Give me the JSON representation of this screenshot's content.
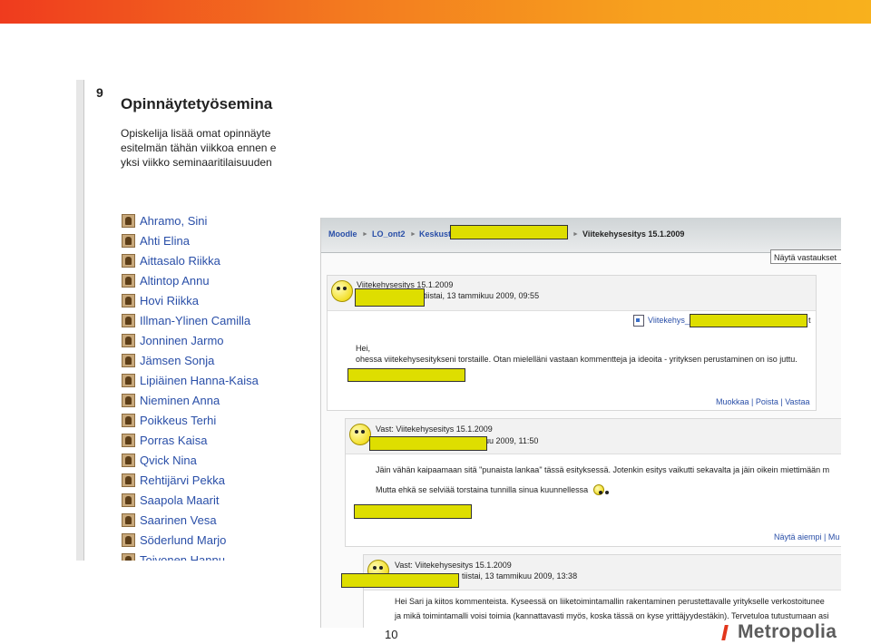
{
  "left_screenshot": {
    "week_number": "9",
    "title": "Opinnäytetyösemina",
    "description_lines": [
      "Opiskelija lisää omat opinnäyte",
      "esitelmän tähän viikkoa ennen e",
      "yksi viikko seminaaritilaisuuden"
    ],
    "students": [
      "Ahramo, Sini",
      "Ahti Elina",
      "Aittasalo Riikka",
      "Altintop Annu",
      "Hovi Riikka",
      "Illman-Ylinen Camilla",
      "Jonninen Jarmo",
      "Jämsen Sonja",
      "Lipiäinen Hanna-Kaisa",
      "Nieminen Anna",
      "Poikkeus Terhi",
      "Porras Kaisa",
      "Qvick Nina",
      "Rehtijärvi Pekka",
      "Saapola Maarit",
      "Saarinen Vesa",
      "Söderlund Marjo",
      "Toivonen Hannu"
    ]
  },
  "right_screenshot": {
    "breadcrumb": {
      "moodle": "Moodle",
      "course": "LO_ont2",
      "forum": "Keskust",
      "current": "Viitekehysesitys 15.1.2009"
    },
    "display_select": "Näytä vastaukset",
    "posts": [
      {
        "subject": "Viitekehysesitys 15.1.2009",
        "date": "tiistai, 13 tammikuu 2009, 09:55",
        "attachment": "Viitekehys_",
        "attachment_tail": "t",
        "body_lines": [
          "Hei,",
          "ohessa viitekehysesitykseni torstaille. Otan mielelläni vastaan kommentteja ja ideoita - yrityksen perustaminen on iso juttu."
        ],
        "actions": "Muokkaa | Poista | Vastaa"
      },
      {
        "subject": "Vast: Viitekehysesitys 15.1.2009",
        "date": "uu 2009, 11:50",
        "body_lines": [
          "Jäin vähän kaipaamaan sitä \"punaista lankaa\" tässä esityksessä. Jotenkin esitys vaikutti sekavalta ja jäin oikein miettimään m",
          "Mutta ehkä se selviää torstaina tunnilla sinua kuunnellessa"
        ],
        "actions": "Näytä aiempi | Mu"
      },
      {
        "subject": "Vast: Viitekehysesitys 15.1.2009",
        "date": "tiistai, 13 tammikuu 2009, 13:38",
        "body_lines": [
          "Hei Sari ja kiitos kommenteista. Kyseessä on liiketoimintamallin rakentaminen perustettavalle yritykselle verkostoitunee",
          "ja mikä toimintamalli voisi toimia (kannattavasti myös, koska tässä on kyse  yrittäjyydestäkin). Tervetuloa tutustumaan asi"
        ]
      }
    ]
  },
  "slide": {
    "page_number": "10",
    "logo_text": "Metropolia"
  },
  "colors": {
    "topbar_start": "#ef3b1e",
    "topbar_end": "#f8b11d",
    "link": "#2a4fa8",
    "redaction": "#dede00",
    "logo_accent": "#e2361c"
  }
}
